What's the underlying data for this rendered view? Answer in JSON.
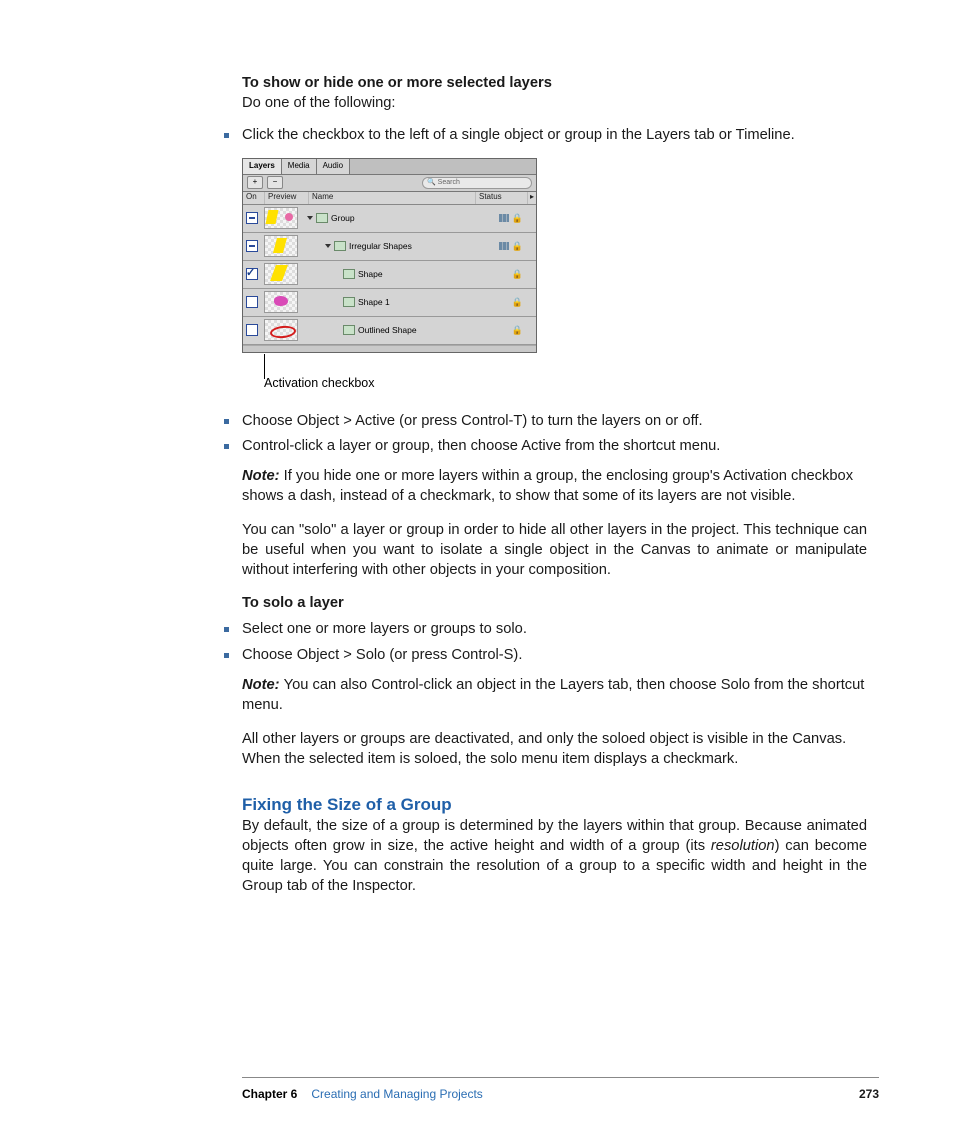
{
  "section1": {
    "heading": "To show or hide one or more selected layers",
    "lead": "Do one of the following:"
  },
  "bullets1": [
    "Click the checkbox to the left of a single object or group in the Layers tab or Timeline."
  ],
  "layersPanel": {
    "tabs": [
      "Layers",
      "Media",
      "Audio"
    ],
    "buttons": {
      "plus": "+",
      "minus": "−"
    },
    "searchPlaceholder": "Search",
    "cols": {
      "on": "On",
      "preview": "Preview",
      "name": "Name",
      "status": "Status",
      "arrow": "▸"
    },
    "rows": [
      {
        "check": "minus",
        "indent": 0,
        "disclosure": true,
        "label": "Group",
        "status": [
          "bars",
          "lock"
        ]
      },
      {
        "check": "minus",
        "indent": 1,
        "disclosure": true,
        "label": "Irregular Shapes",
        "status": [
          "bars",
          "lock"
        ]
      },
      {
        "check": "check",
        "indent": 2,
        "disclosure": false,
        "label": "Shape",
        "status": [
          "lock"
        ]
      },
      {
        "check": "empty",
        "indent": 2,
        "disclosure": false,
        "label": "Shape 1",
        "status": [
          "lock"
        ]
      },
      {
        "check": "empty",
        "indent": 2,
        "disclosure": false,
        "label": "Outlined Shape",
        "status": [
          "lock"
        ]
      }
    ],
    "callout": "Activation checkbox"
  },
  "bullets2": [
    "Choose Object > Active (or press Control-T) to turn the layers on or off.",
    "Control-click a layer or group, then choose Active from the shortcut menu."
  ],
  "note1": {
    "label": "Note:",
    "text": "If you hide one or more layers within a group, the enclosing group's Activation checkbox shows a dash, instead of a checkmark, to show that some of its layers are not visible."
  },
  "para1": "You can \"solo\" a layer or group in order to hide all other layers in the project. This technique can be useful when you want to isolate a single object in the Canvas to animate or manipulate without interfering with other objects in your composition.",
  "section2": {
    "heading": "To solo a layer"
  },
  "bullets3": [
    "Select one or more layers or groups to solo.",
    "Choose Object > Solo (or press Control-S)."
  ],
  "note2": {
    "label": "Note:",
    "text": "You can also Control-click an object in the Layers tab, then choose Solo from the shortcut menu."
  },
  "para2": "All other layers or groups are deactivated, and only the soloed object is visible in the Canvas. When the selected item is soloed, the solo menu item displays a checkmark.",
  "section3": {
    "heading": "Fixing the Size of a Group",
    "body_a": "By default, the size of a group is determined by the layers within that group. Because animated objects often grow in size, the active height and width of a group (its ",
    "body_ital": "resolution",
    "body_b": ") can become quite large. You can constrain the resolution of a group to a specific width and height in the Group tab of the Inspector."
  },
  "footer": {
    "chapter": "Chapter 6",
    "title": "Creating and Managing Projects",
    "page": "273"
  }
}
